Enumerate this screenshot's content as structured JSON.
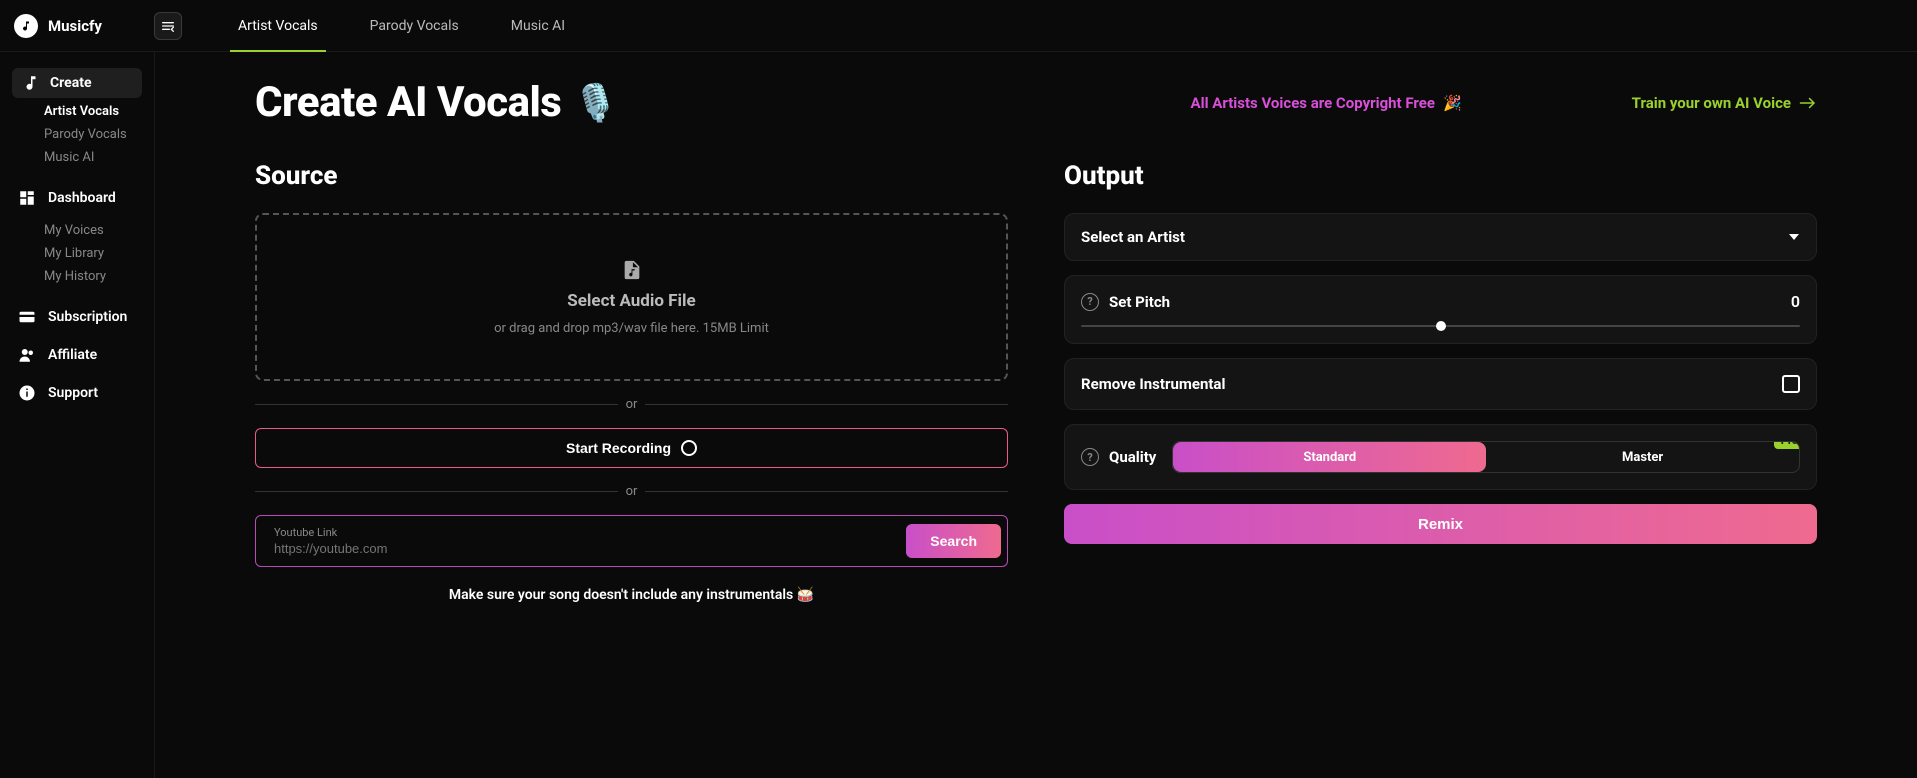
{
  "brand": "Musicfy",
  "topTabs": [
    "Artist Vocals",
    "Parody Vocals",
    "Music AI"
  ],
  "sidebar": {
    "create": {
      "label": "Create",
      "items": [
        "Artist Vocals",
        "Parody Vocals",
        "Music AI"
      ]
    },
    "dashboard": {
      "label": "Dashboard",
      "items": [
        "My Voices",
        "My Library",
        "My History"
      ]
    },
    "subscription": "Subscription",
    "affiliate": "Affiliate",
    "support": "Support"
  },
  "page": {
    "title": "Create AI Vocals",
    "titleIcon": "🎙️",
    "copyrightFree": "All Artists Voices are Copyright Free",
    "copyrightIcon": "🎉",
    "trainLink": "Train your own AI Voice"
  },
  "source": {
    "heading": "Source",
    "dropTitle": "Select Audio File",
    "dropSub": "or drag and drop mp3/wav file here. 15MB Limit",
    "or": "or",
    "record": "Start Recording",
    "ytLabel": "Youtube Link",
    "ytPlaceholder": "https://youtube.com",
    "search": "Search",
    "hint": "Make sure your song doesn't include any instrumentals 🥁"
  },
  "output": {
    "heading": "Output",
    "selectArtist": "Select an Artist",
    "pitchLabel": "Set Pitch",
    "pitchValue": "0",
    "removeInstr": "Remove Instrumental",
    "qualityLabel": "Quality",
    "qualityOptions": [
      "Standard",
      "Master"
    ],
    "proBadge": "Pro",
    "remix": "Remix"
  }
}
